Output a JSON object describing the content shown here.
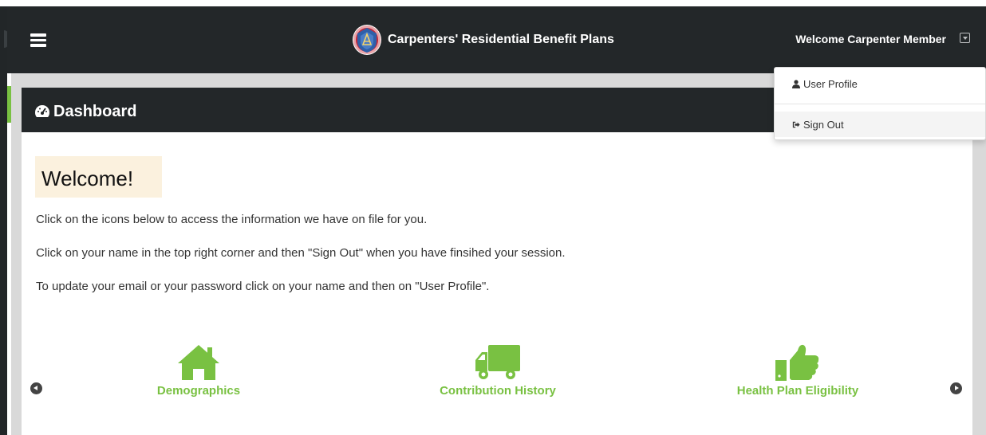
{
  "app": {
    "title": "Carpenters' Residential Benefit Plans",
    "logo_icon": "carpenters-seal-logo"
  },
  "navbar": {
    "menu_icon": "hamburger-icon",
    "user_label": "Welcome Carpenter Member",
    "user_caret_icon": "caret-down-square-icon"
  },
  "dropdown": {
    "items": [
      {
        "label": "User Profile",
        "icon": "user-icon"
      },
      {
        "label": "Sign Out",
        "icon": "sign-out-icon"
      }
    ]
  },
  "dashboard": {
    "title": "Dashboard",
    "title_icon": "tachometer-icon",
    "welcome_heading": "Welcome!",
    "intro_lines": [
      "Click on the icons below to access the information we have on file for you.",
      "Click on your name in the top right corner and then \"Sign Out\" when you have finsihed your session.",
      "To update your email or your password click on your name and then on \"User Profile\"."
    ],
    "tiles": [
      {
        "label": "Demographics",
        "icon": "home-icon"
      },
      {
        "label": "Contribution History",
        "icon": "truck-icon"
      },
      {
        "label": "Health Plan Eligibility",
        "icon": "thumbs-up-icon"
      }
    ],
    "carousel": {
      "prev_icon": "chevron-circle-left-icon",
      "next_icon": "chevron-circle-right-icon"
    }
  },
  "colors": {
    "navbar_bg": "#232729",
    "accent_green": "#79c142",
    "welcome_bg": "#fbf1de",
    "content_bg": "#d9d9d9"
  }
}
